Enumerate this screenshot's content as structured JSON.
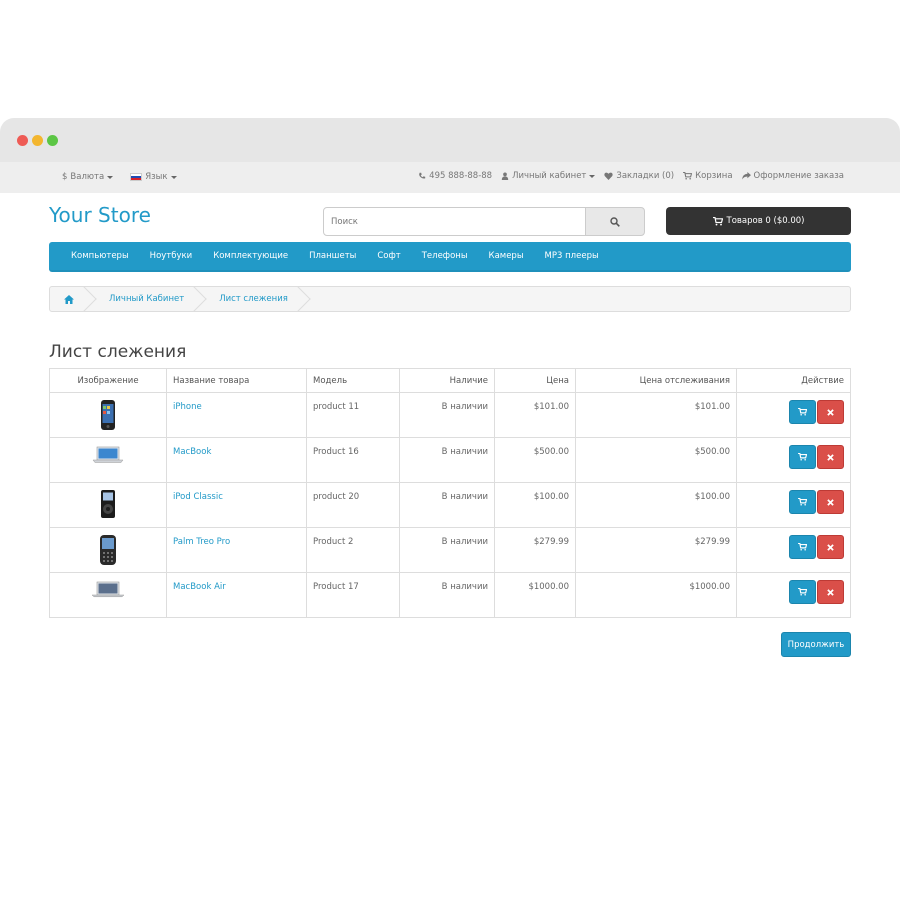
{
  "topbar": {
    "currency": "Валюта",
    "language": "Язык",
    "phone": "495 888-88-88",
    "account": "Личный кабинет",
    "wishlist": "Закладки (0)",
    "cart": "Корзина",
    "checkout": "Оформление заказа"
  },
  "header": {
    "logo": "Your Store",
    "search_placeholder": "Поиск",
    "cart_button": "Товаров 0 ($0.00)"
  },
  "menu": [
    "Компьютеры",
    "Ноутбуки",
    "Комплектующие",
    "Планшеты",
    "Софт",
    "Телефоны",
    "Камеры",
    "MP3 плееры"
  ],
  "breadcrumb": [
    "Личный Кабинет",
    "Лист слежения"
  ],
  "page_title": "Лист слежения",
  "table": {
    "headers": [
      "Изображение",
      "Название товара",
      "Модель",
      "Наличие",
      "Цена",
      "Цена отслеживания",
      "Действие"
    ],
    "rows": [
      {
        "name": "iPhone",
        "model": "product 11",
        "stock": "В наличии",
        "price": "$101.00",
        "tracked": "$101.00",
        "image": "iphone"
      },
      {
        "name": "MacBook",
        "model": "Product 16",
        "stock": "В наличии",
        "price": "$500.00",
        "tracked": "$500.00",
        "image": "macbook"
      },
      {
        "name": "iPod Classic",
        "model": "product 20",
        "stock": "В наличии",
        "price": "$100.00",
        "tracked": "$100.00",
        "image": "ipod"
      },
      {
        "name": "Palm Treo Pro",
        "model": "Product 2",
        "stock": "В наличии",
        "price": "$279.99",
        "tracked": "$279.99",
        "image": "palm"
      },
      {
        "name": "MacBook Air",
        "model": "Product 17",
        "stock": "В наличии",
        "price": "$1000.00",
        "tracked": "$1000.00",
        "image": "macbook-air"
      }
    ]
  },
  "continue_button": "Продолжить",
  "colors": {
    "accent": "#229ac8",
    "danger": "#da4f49",
    "dark": "#333333"
  }
}
